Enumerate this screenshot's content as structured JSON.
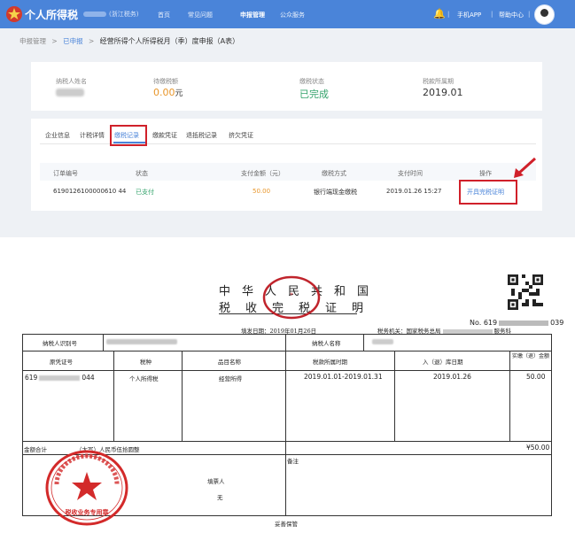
{
  "app": {
    "brand": "个人所得税",
    "region": "浙江税务",
    "nav": [
      "首页",
      "常见问题",
      "申报管理",
      "公众服务"
    ],
    "active_nav": "申报管理",
    "mobile_app": "手机APP",
    "help": "帮助中心",
    "colors": {
      "topbar": "#4a84d9",
      "accent": "#4a84d9",
      "orange": "#e8962a",
      "green": "#33a36b",
      "red": "#d0202a"
    }
  },
  "breadcrumb": {
    "root": "申报管理",
    "sep": ">",
    "level2": "已申报",
    "current": "经营所得个人所得税月（季）度申报（A表）"
  },
  "summary": {
    "taxpayer_label": "纳税人姓名",
    "amount_label": "待缴税额",
    "amount_value": "0.00",
    "amount_unit": "元",
    "status_label": "缴税状态",
    "status_value": "已完成",
    "period_label": "税款所属期",
    "period_value": "2019.01"
  },
  "tabs": [
    "企业信息",
    "计税详情",
    "缴税记录",
    "缴款凭证",
    "退抵税记录",
    "挤欠凭证"
  ],
  "active_tab": "缴税记录",
  "table": {
    "headers": [
      "订单编号",
      "状态",
      "支付金额（元）",
      "缴税方式",
      "支付时间",
      "操作"
    ],
    "row": {
      "order_no": "6190126100000610 44",
      "status": "已支付",
      "amount": "50.00",
      "method": "银行端现金缴税",
      "time": "2019.01.26 15:27",
      "action": "开具完税证明"
    }
  },
  "certificate": {
    "title_line1": [
      "中",
      "华",
      "人",
      "民",
      "共",
      "和",
      "国"
    ],
    "title_line2": [
      "税",
      "收",
      "完",
      "税",
      "证",
      "明"
    ],
    "number": "No. 619",
    "number_suffix": "039",
    "issue_date_label": "填发日期：",
    "issue_date": "2019年01月26日",
    "authority_label": "税务机关：国家税务总局",
    "authority_suffix": "服务科",
    "taxpayer_id_label": "纳税人识别号",
    "taxpayer_name_label": "纳税人名称",
    "headers": [
      "原凭证号",
      "税种",
      "品目名称",
      "税款所属时期",
      "入（退）库日期",
      "实缴（退）金额"
    ],
    "row": {
      "voucher_prefix": "619",
      "voucher_suffix": "044",
      "tax_type": "个人所得税",
      "item": "经营所得",
      "period": "2019.01.01-2019.01.31",
      "date": "2019.01.26",
      "amount": "50.00"
    },
    "total_label": "金额合计",
    "total_words": "（大写）人民币伍拾圆整",
    "total_amount": "¥50.00",
    "preparer_label": "填票人",
    "preparer_value": "无",
    "remark_label": "备注",
    "footer": "妥善保管",
    "seal_text": "税收业务专用章"
  }
}
